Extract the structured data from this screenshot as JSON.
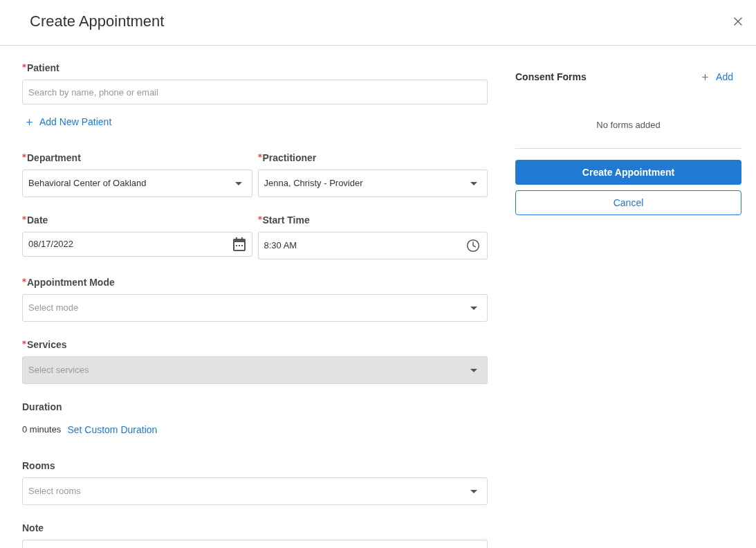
{
  "dialog": {
    "title": "Create Appointment"
  },
  "form": {
    "rows": [
      {
        "fields": [
          {
            "kind": "search",
            "label": "Patient",
            "required": true,
            "placeholder": "Search by name, phone or email"
          }
        ]
      },
      {
        "fields": [
          {
            "kind": "add_link",
            "label": "Add New Patient"
          }
        ]
      },
      {
        "fields": [
          {
            "kind": "select",
            "label": "Department",
            "required": true,
            "value": "Behavioral Center of Oakland",
            "disabled": false
          },
          {
            "kind": "select",
            "label": "Practitioner",
            "required": true,
            "value": "Jenna, Christy - Provider",
            "disabled": false
          }
        ]
      },
      {
        "fields": [
          {
            "kind": "date",
            "label": "Date",
            "required": true,
            "value": "08/17/2022"
          },
          {
            "kind": "time",
            "label": "Start Time",
            "required": true,
            "value": "8:30 AM"
          }
        ]
      },
      {
        "fields": [
          {
            "kind": "select",
            "label": "Appointment Mode",
            "required": true,
            "placeholder": "Select mode",
            "disabled": false
          }
        ]
      },
      {
        "fields": [
          {
            "kind": "select",
            "label": "Services",
            "required": true,
            "placeholder": "Select services",
            "disabled": true
          }
        ]
      },
      {
        "fields": [
          {
            "kind": "duration",
            "label": "Duration",
            "required": false,
            "value": "0 minutes",
            "link": "Set Custom Duration"
          }
        ]
      },
      {
        "fields": [
          {
            "kind": "select",
            "label": "Rooms",
            "required": false,
            "placeholder": "Select rooms",
            "disabled": false
          }
        ]
      },
      {
        "fields": [
          {
            "kind": "textarea",
            "label": "Note",
            "required": false
          }
        ]
      }
    ]
  },
  "consent_forms": {
    "title": "Consent Forms",
    "add_label": "Add",
    "empty_text": "No forms added"
  },
  "actions": [
    {
      "kind": "primary",
      "label": "Create Appointment"
    },
    {
      "kind": "secondary",
      "label": "Cancel"
    }
  ]
}
